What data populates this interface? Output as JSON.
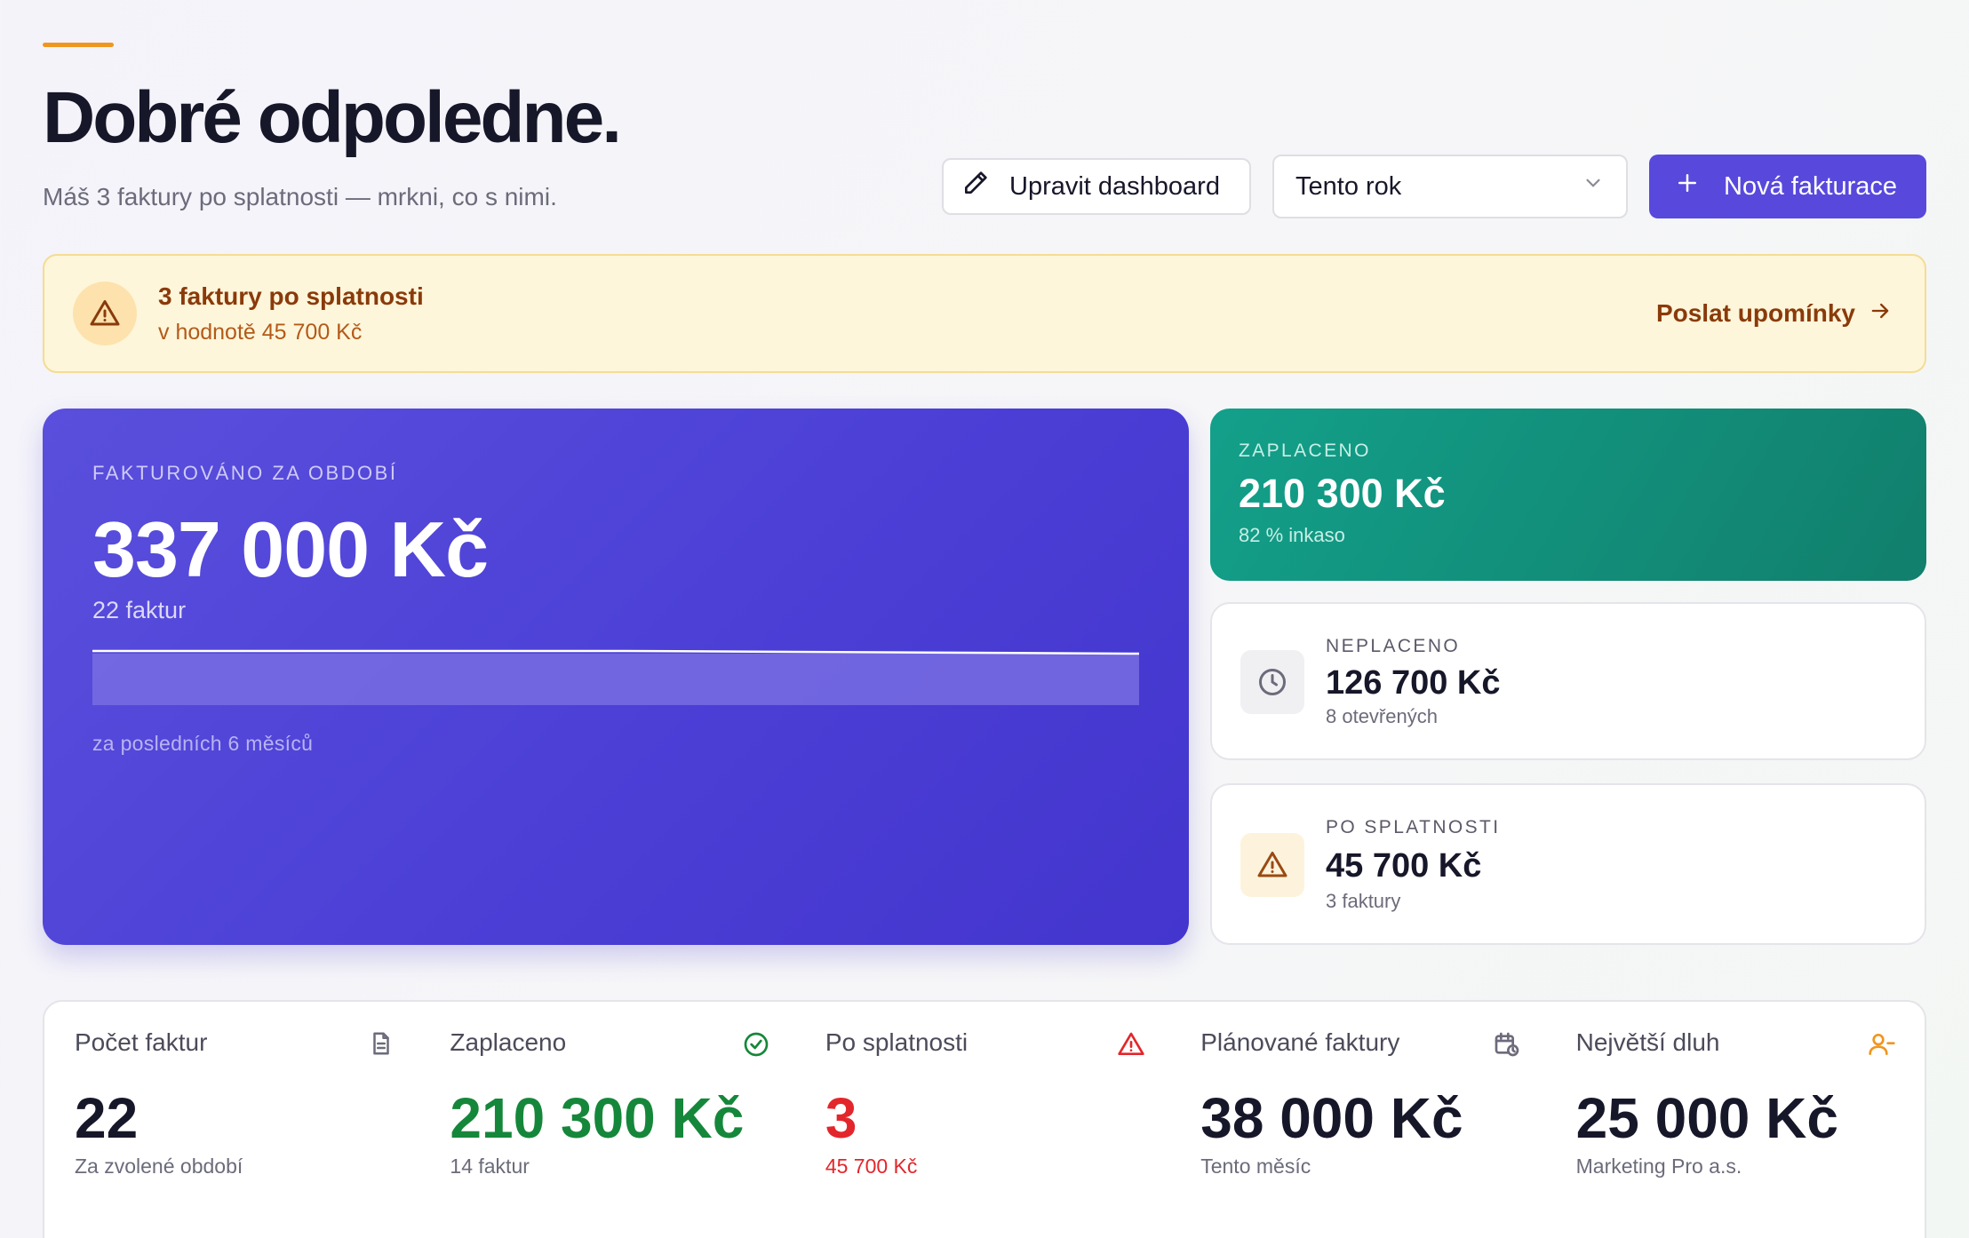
{
  "header": {
    "greeting": "Dobré odpoledne.",
    "subtitle": "Máš 3 faktury po splatnosti — mrkni, co s nimi."
  },
  "toolbar": {
    "edit_label": "Upravit dashboard",
    "period_value": "Tento rok",
    "new_label": "Nová fakturace"
  },
  "alert": {
    "title": "3 faktury po splatnosti",
    "subtitle": "v hodnotě 45 700 Kč",
    "action": "Poslat upomínky"
  },
  "hero": {
    "label": "FAKTUROVÁNO ZA OBDOBÍ",
    "value": "337 000 Kč",
    "count": "22 faktur",
    "footnote": "za posledních 6 měsíců"
  },
  "cards": {
    "paid": {
      "label": "ZAPLACENO",
      "value": "210 300 Kč",
      "sub": "82 % inkaso"
    },
    "unpaid": {
      "label": "NEPLACENO",
      "value": "126 700 Kč",
      "sub": "8 otevřených"
    },
    "overdue": {
      "label": "PO SPLATNOSTI",
      "value": "45 700 Kč",
      "sub": "3 faktury"
    }
  },
  "stats": [
    {
      "label": "Počet faktur",
      "value": "22",
      "sub": "Za zvolené období",
      "icon": "document-icon"
    },
    {
      "label": "Zaplaceno",
      "value": "210 300 Kč",
      "sub": "14 faktur",
      "icon": "check-circle-icon"
    },
    {
      "label": "Po splatnosti",
      "value": "3",
      "sub": "45 700 Kč",
      "icon": "warning-icon"
    },
    {
      "label": "Plánované faktury",
      "value": "38 000 Kč",
      "sub": "Tento měsíc",
      "icon": "calendar-clock-icon"
    },
    {
      "label": "Největší dluh",
      "value": "25 000 Kč",
      "sub": "Marketing Pro a.s.",
      "icon": "user-minus-icon"
    }
  ],
  "colors": {
    "accent": "#5849dc",
    "paid_green": "#13a08a",
    "stat_green": "#15873a",
    "stat_red": "#e3262b",
    "warning_orange": "#f0961e"
  }
}
